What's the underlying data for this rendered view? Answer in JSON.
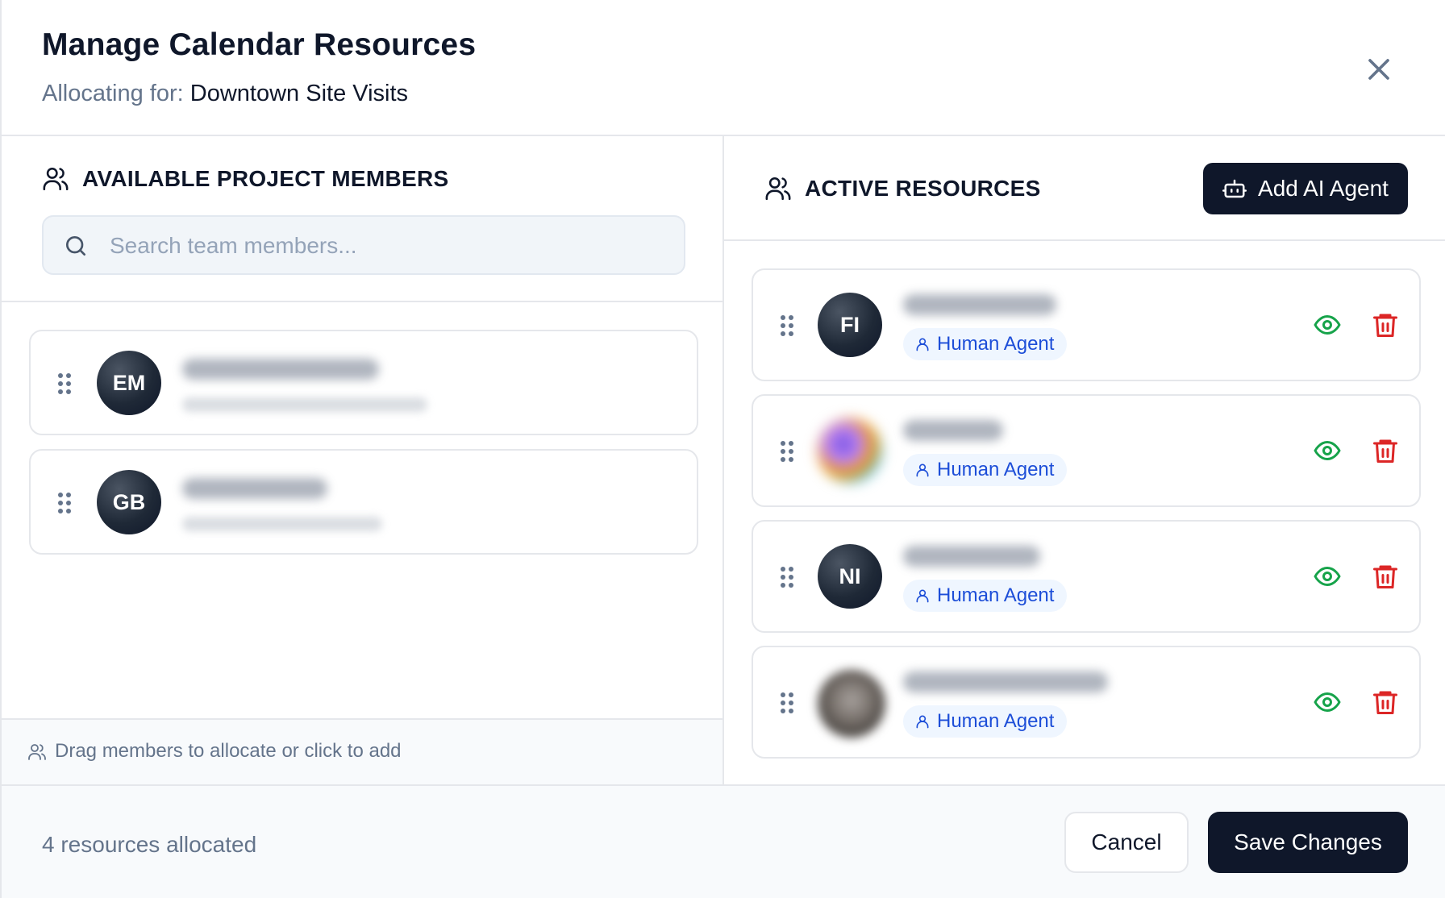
{
  "header": {
    "title": "Manage Calendar Resources",
    "subtitle_prefix": "Allocating for:",
    "subtitle_value": "Downtown Site Visits",
    "close_icon": "close-icon"
  },
  "left_panel": {
    "title": "AVAILABLE PROJECT MEMBERS",
    "title_icon": "users-icon",
    "search": {
      "placeholder": "Search team members...",
      "value": "",
      "icon": "search-icon"
    },
    "members": [
      {
        "initials": "EM"
      },
      {
        "initials": "GB"
      }
    ],
    "hint": "Drag members to allocate or click to add"
  },
  "right_panel": {
    "title": "ACTIVE RESOURCES",
    "title_icon": "users-icon",
    "add_ai_agent_label": "Add AI Agent",
    "add_ai_agent_icon": "bot-icon",
    "resources": [
      {
        "initials": "FI",
        "badge": "Human Agent"
      },
      {
        "initials": "",
        "badge": "Human Agent"
      },
      {
        "initials": "NI",
        "badge": "Human Agent"
      },
      {
        "initials": "",
        "badge": "Human Agent"
      }
    ]
  },
  "footer": {
    "count_text": "4 resources allocated",
    "cancel_label": "Cancel",
    "save_label": "Save Changes"
  },
  "colors": {
    "primary": "#0f172a",
    "muted_text": "#64748b",
    "badge_bg": "#eff6ff",
    "badge_text": "#1d4ed8",
    "eye_green": "#16a34a",
    "trash_red": "#dc2626",
    "border": "#e5e7eb"
  }
}
